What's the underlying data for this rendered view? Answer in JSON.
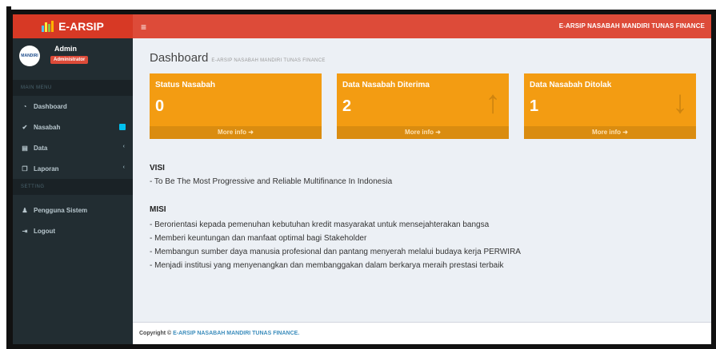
{
  "app": {
    "logo_text": "E-ARSIP",
    "navbar_title": "E-ARSIP NASABAH MANDIRI TUNAS FINANCE",
    "toggle_icon": "≡"
  },
  "user": {
    "name": "Admin",
    "role": "Administrator"
  },
  "sidebar": {
    "main_section": "MAIN MENU",
    "settings_section": "SETTING",
    "items": [
      {
        "label": "Dashboard",
        "icon": "dashboard-icon"
      },
      {
        "label": "Nasabah",
        "icon": "check-icon"
      },
      {
        "label": "Data",
        "icon": "database-icon"
      },
      {
        "label": "Laporan",
        "icon": "copy-icon"
      },
      {
        "label": "Pengguna Sistem",
        "icon": "user-icon"
      },
      {
        "label": "Logout",
        "icon": "logout-icon"
      }
    ]
  },
  "page": {
    "title": "Dashboard",
    "subtitle": "E-ARSIP NASABAH MANDIRI TUNAS FINANCE"
  },
  "boxes": [
    {
      "title": "Status Nasabah",
      "value": "0",
      "more": "More info ➜",
      "icon": ""
    },
    {
      "title": "Data Nasabah Diterima",
      "value": "2",
      "more": "More info ➜",
      "icon": "arrow-up-icon"
    },
    {
      "title": "Data Nasabah Ditolak",
      "value": "1",
      "more": "More info ➜",
      "icon": "arrow-down-icon"
    }
  ],
  "visi": {
    "heading": "VISI",
    "lines": [
      "- To Be The Most Progressive and Reliable Multifinance In Indonesia"
    ]
  },
  "misi": {
    "heading": "MISI",
    "lines": [
      "- Berorientasi kepada pemenuhan kebutuhan kredit masyarakat untuk mensejahterakan bangsa",
      "- Memberi keuntungan dan manfaat optimal bagi Stakeholder",
      "- Membangun sumber daya manusia profesional dan pantang menyerah melalui budaya kerja PERWIRA",
      "- Menjadi institusi yang menyenangkan dan membanggakan dalam berkarya meraih prestasi terbaik"
    ]
  },
  "footer": {
    "prefix": "Copyright © ",
    "link": "E-ARSIP NASABAH MANDIRI TUNAS FINANCE."
  },
  "colors": {
    "header_logo": "#d73925",
    "header_bar": "#dd4b39",
    "sidebar": "#222d32",
    "box": "#f39c12",
    "content_bg": "#ecf0f5"
  }
}
